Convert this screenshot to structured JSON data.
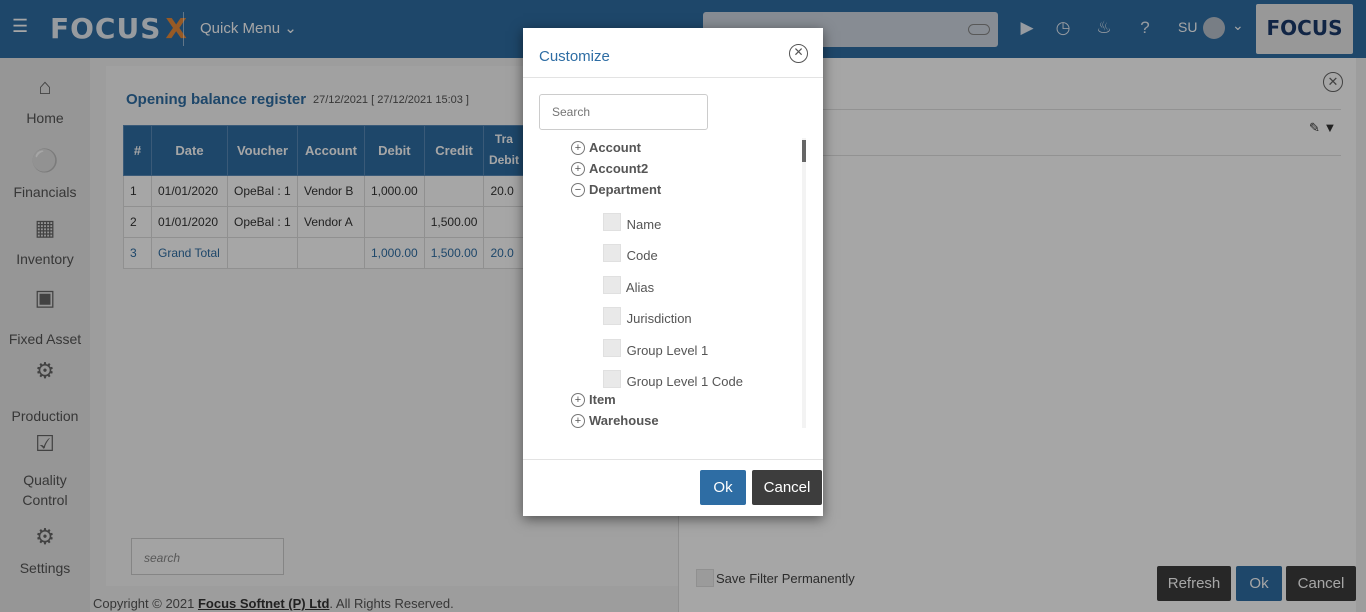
{
  "topbar": {
    "logo_text": "FOCUS",
    "logo_x": "X",
    "quick_menu": "Quick Menu",
    "user_initials": "SU",
    "brand": "FOCUS"
  },
  "sidebar": {
    "items": [
      {
        "label": "Home",
        "icon": "home-icon"
      },
      {
        "label": "Financials",
        "icon": "financials-icon"
      },
      {
        "label": "Inventory",
        "icon": "inventory-icon"
      },
      {
        "label": "Fixed Asset",
        "icon": "fixed-asset-icon"
      },
      {
        "label": "Production",
        "icon": "production-icon"
      },
      {
        "label": "Quality Control",
        "icon": "quality-control-icon"
      },
      {
        "label": "Settings",
        "icon": "settings-icon"
      }
    ]
  },
  "report": {
    "title": "Opening balance register",
    "subtitle": "27/12/2021 [ 27/12/2021 15:03 ]",
    "columns": [
      "#",
      "Date",
      "Voucher",
      "Account",
      "Debit",
      "Credit",
      "Tra",
      "Debit"
    ],
    "rows": [
      {
        "n": "1",
        "date": "01/01/2020",
        "voucher": "OpeBal : 1",
        "account": "Vendor B",
        "debit": "1,000.00",
        "credit": "",
        "tdebit": "20.0"
      },
      {
        "n": "2",
        "date": "01/01/2020",
        "voucher": "OpeBal : 1",
        "account": "Vendor A",
        "debit": "",
        "credit": "1,500.00",
        "tdebit": ""
      },
      {
        "n": "3",
        "date": "Grand Total",
        "voucher": "",
        "account": "",
        "debit": "1,000.00",
        "credit": "1,500.00",
        "tdebit": "20.0"
      }
    ],
    "search_placeholder": "search"
  },
  "footer": {
    "prefix": "Copyright © 2021 ",
    "company": "Focus Softnet (P) Ltd",
    "suffix": ". All Rights Reserved."
  },
  "filter_panel": {
    "save_filter_label": "Save Filter Permanently",
    "refresh": "Refresh",
    "ok": "Ok",
    "cancel": "Cancel"
  },
  "modal": {
    "title": "Customize",
    "search_placeholder": "Search",
    "tree": [
      {
        "label": "Account",
        "state": "+"
      },
      {
        "label": "Account2",
        "state": "+"
      },
      {
        "label": "Department",
        "state": "−"
      },
      {
        "label": "Item",
        "state": "+"
      },
      {
        "label": "Warehouse",
        "state": "+"
      }
    ],
    "department_fields": [
      "Name",
      "Code",
      "Alias",
      "Jurisdiction",
      "Group Level 1",
      "Group Level 1 Code"
    ],
    "ok": "Ok",
    "cancel": "Cancel"
  }
}
